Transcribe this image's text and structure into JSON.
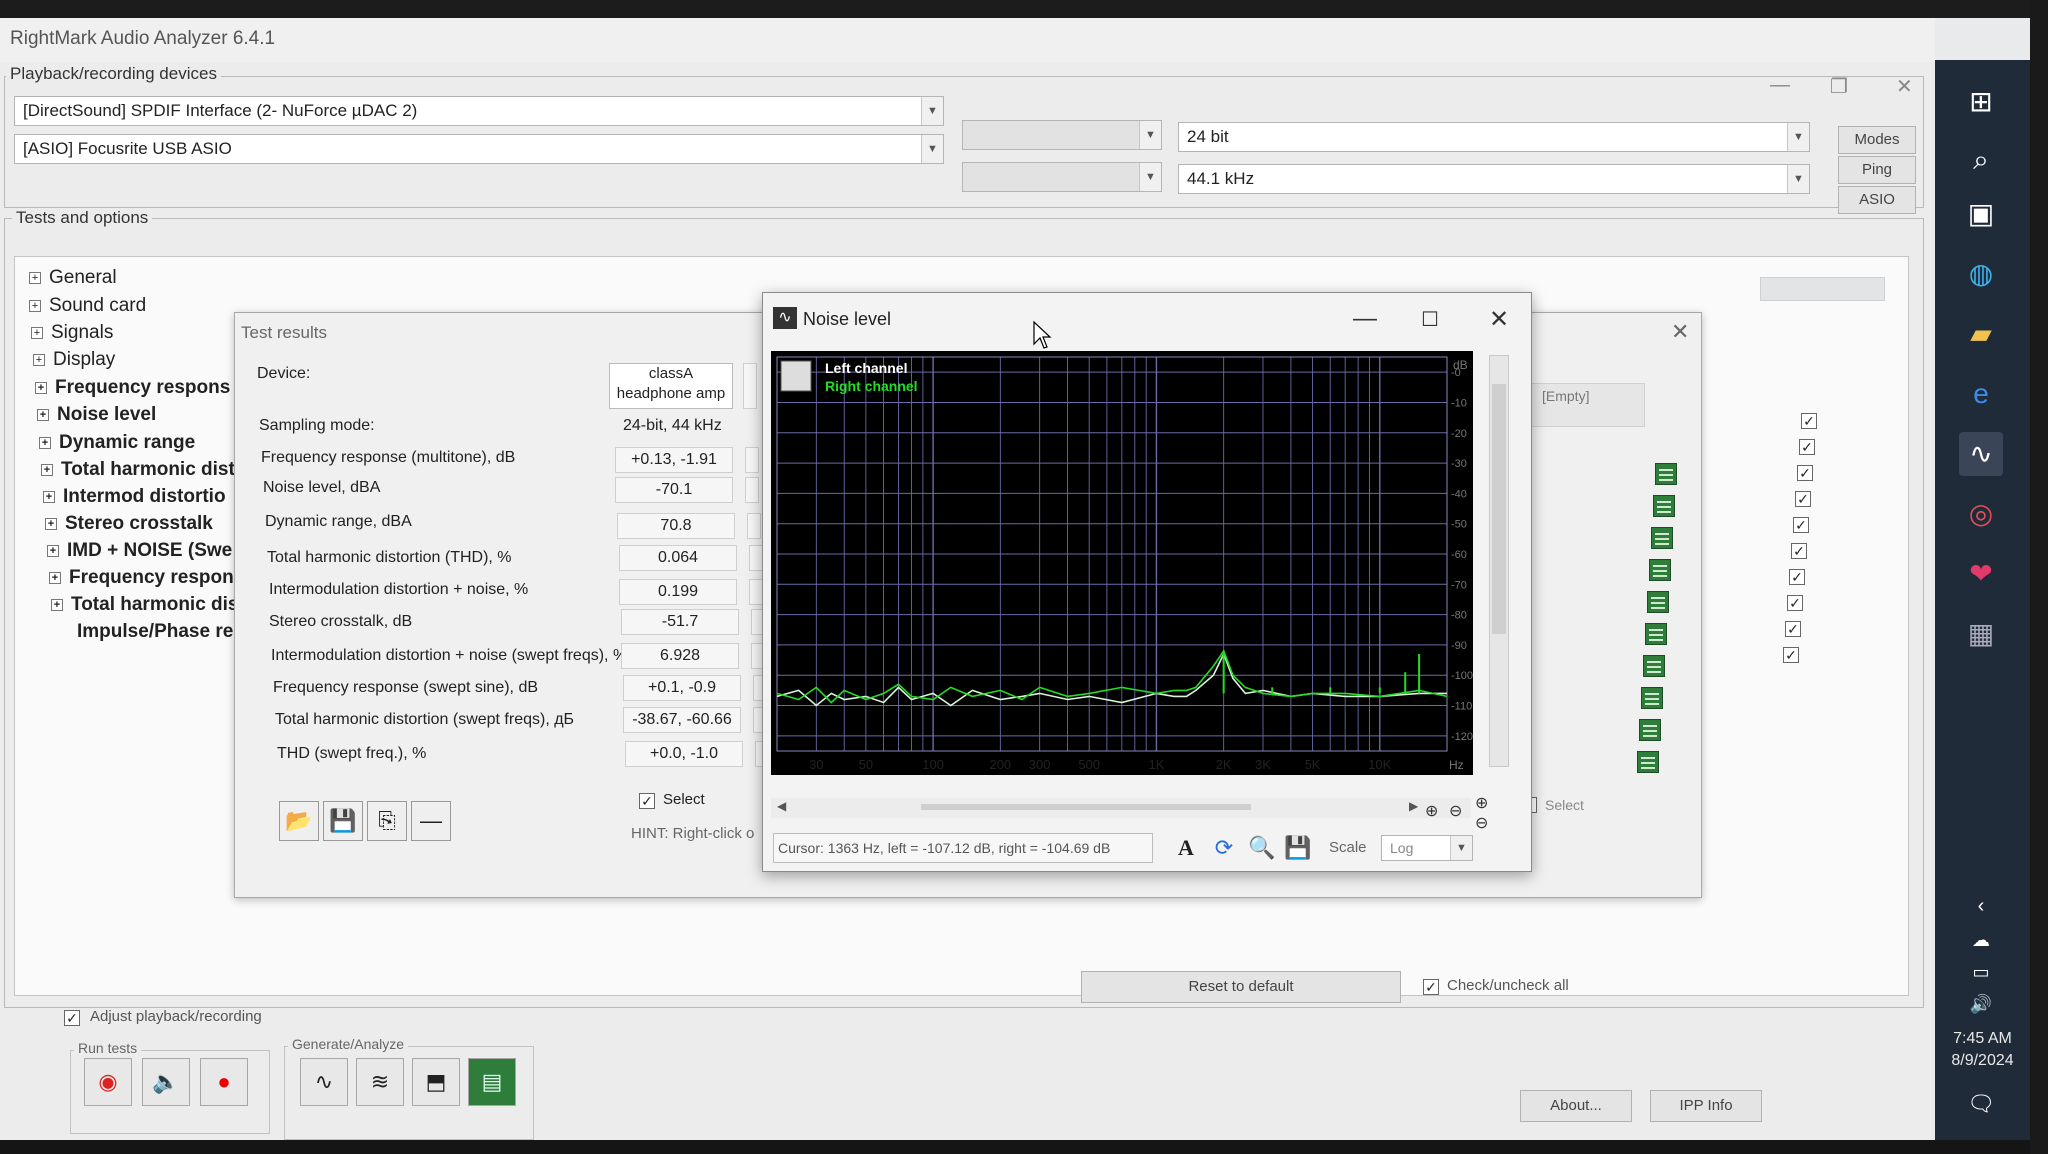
{
  "app": {
    "title": "RightMark Audio Analyzer 6.4.1"
  },
  "devices": {
    "group_label": "Playback/recording devices",
    "playback_device": "[DirectSound] SPDIF Interface (2- NuForce µDAC 2)",
    "recording_device": "[ASIO] Focusrite USB ASIO",
    "bit_depth": "24 bit",
    "sample_rate": "44.1 kHz",
    "buttons": {
      "modes": "Modes",
      "ping": "Ping",
      "asio": "ASIO"
    }
  },
  "tests": {
    "group_label": "Tests and options",
    "items": [
      {
        "label": "General",
        "bold": false
      },
      {
        "label": "Sound card",
        "bold": false
      },
      {
        "label": "Signals",
        "bold": false
      },
      {
        "label": "Display",
        "bold": false
      },
      {
        "label": "Frequency respons",
        "bold": true
      },
      {
        "label": "Noise level",
        "bold": true
      },
      {
        "label": "Dynamic range",
        "bold": true
      },
      {
        "label": "Total harmonic dist",
        "bold": true
      },
      {
        "label": "Intermod distortio",
        "bold": true
      },
      {
        "label": "Stereo crosstalk",
        "bold": true
      },
      {
        "label": "IMD + NOISE (Swe",
        "bold": true
      },
      {
        "label": "Frequency respons",
        "bold": true
      },
      {
        "label": "Total harmonic dist",
        "bold": true
      },
      {
        "label": "Impulse/Phase res",
        "bold": true
      }
    ],
    "empty_label": "[Empty]",
    "select_label": "Select",
    "reset_button": "Reset to default",
    "check_all_label": "Check/uncheck all"
  },
  "results": {
    "title": "Test results",
    "device_label": "Device:",
    "device_value_line1": "classA",
    "device_value_line2": "headphone amp",
    "rows": [
      {
        "label": "Sampling mode:",
        "value": "24-bit, 44 kHz"
      },
      {
        "label": "Frequency response (multitone), dB",
        "value": "+0.13, -1.91"
      },
      {
        "label": "Noise level, dBA",
        "value": "-70.1"
      },
      {
        "label": "Dynamic range, dBA",
        "value": "70.8"
      },
      {
        "label": "Total harmonic distortion (THD), %",
        "value": "0.064"
      },
      {
        "label": "Intermodulation distortion + noise, %",
        "value": "0.199"
      },
      {
        "label": "Stereo crosstalk, dB",
        "value": "-51.7"
      },
      {
        "label": "Intermodulation distortion + noise (swept freqs), %",
        "value": "6.928"
      },
      {
        "label": "Frequency response (swept sine), dB",
        "value": "+0.1, -0.9"
      },
      {
        "label": "Total harmonic distortion (swept freqs), дБ",
        "value": "-38.67, -60.66"
      },
      {
        "label": "THD (swept freq.), %",
        "value": "+0.0, -1.0"
      }
    ],
    "select_label": "Select",
    "hint": "HINT: Right-click o"
  },
  "noise_window": {
    "title": "Noise level",
    "legend_left": "Left channel",
    "legend_right": "Right channel",
    "y_unit": "dB",
    "x_unit": "Hz",
    "status": "Cursor: 1363 Hz, left = -107.12 dB, right = -104.69 dB",
    "scale_label": "Scale",
    "scale_value": "Log",
    "colors": {
      "left": "#d8f5d8",
      "right": "#22dd22",
      "grid": "#6a6aa8"
    }
  },
  "chart_data": {
    "type": "line",
    "title": "",
    "xlabel": "Hz",
    "ylabel": "dB",
    "x_scale": "log",
    "xlim": [
      20,
      20000
    ],
    "ylim": [
      -125,
      5
    ],
    "x_ticks": [
      {
        "v": 30,
        "label": "30"
      },
      {
        "v": 50,
        "label": "50"
      },
      {
        "v": 100,
        "label": "100"
      },
      {
        "v": 200,
        "label": "200"
      },
      {
        "v": 300,
        "label": "300"
      },
      {
        "v": 500,
        "label": "500"
      },
      {
        "v": 1000,
        "label": "1K"
      },
      {
        "v": 2000,
        "label": "2K"
      },
      {
        "v": 3000,
        "label": "3K"
      },
      {
        "v": 5000,
        "label": "5K"
      },
      {
        "v": 10000,
        "label": "10K"
      }
    ],
    "y_ticks": [
      {
        "v": 0,
        "label": "-0"
      },
      {
        "v": -10,
        "label": "-10"
      },
      {
        "v": -20,
        "label": "-20"
      },
      {
        "v": -30,
        "label": "-30"
      },
      {
        "v": -40,
        "label": "-40"
      },
      {
        "v": -50,
        "label": "-50"
      },
      {
        "v": -60,
        "label": "-60"
      },
      {
        "v": -70,
        "label": "-70"
      },
      {
        "v": -80,
        "label": "-80"
      },
      {
        "v": -90,
        "label": "-90"
      },
      {
        "v": -100,
        "label": "-100"
      },
      {
        "v": -110,
        "label": "-110"
      },
      {
        "v": -120,
        "label": "-120"
      }
    ],
    "series": [
      {
        "name": "Left channel",
        "color": "#d8f5d8",
        "x": [
          20,
          25,
          30,
          35,
          40,
          50,
          60,
          70,
          80,
          100,
          120,
          150,
          200,
          250,
          300,
          400,
          500,
          700,
          1000,
          1200,
          1363,
          1500,
          1800,
          2000,
          2200,
          2500,
          3000,
          4000,
          5000,
          7000,
          10000,
          15000,
          20000
        ],
        "y": [
          -107,
          -105,
          -110,
          -106,
          -108,
          -107,
          -109,
          -104,
          -108,
          -106,
          -110,
          -105,
          -108,
          -107,
          -106,
          -108,
          -107,
          -109,
          -106,
          -107,
          -107,
          -105,
          -100,
          -93,
          -101,
          -106,
          -105,
          -107,
          -106,
          -107,
          -107,
          -106,
          -106
        ]
      },
      {
        "name": "Right channel",
        "color": "#22dd22",
        "x": [
          20,
          25,
          30,
          35,
          40,
          50,
          60,
          70,
          80,
          100,
          120,
          150,
          200,
          250,
          300,
          400,
          500,
          700,
          1000,
          1200,
          1363,
          1500,
          1800,
          2000,
          2200,
          2500,
          3000,
          4000,
          5000,
          7000,
          10000,
          15000,
          20000
        ],
        "y": [
          -106,
          -108,
          -104,
          -109,
          -105,
          -108,
          -106,
          -103,
          -107,
          -108,
          -104,
          -107,
          -105,
          -108,
          -104,
          -107,
          -106,
          -104,
          -106,
          -105,
          -105,
          -104,
          -97,
          -92,
          -100,
          -104,
          -106,
          -107,
          -106,
          -106,
          -107,
          -105,
          -107
        ]
      }
    ],
    "spikes": [
      {
        "x": 2000,
        "y": -92
      },
      {
        "x": 3300,
        "y": -104
      },
      {
        "x": 6000,
        "y": -104
      },
      {
        "x": 10000,
        "y": -104
      },
      {
        "x": 13000,
        "y": -99
      },
      {
        "x": 15000,
        "y": -93
      }
    ]
  },
  "bottom": {
    "adjust_label": "Adjust playback/recording",
    "run_tests_label": "Run tests",
    "generate_label": "Generate/Analyze",
    "about": "About...",
    "ipp_info": "IPP Info"
  },
  "taskbar": {
    "time": "7:45 AM",
    "date": "8/9/2024"
  }
}
